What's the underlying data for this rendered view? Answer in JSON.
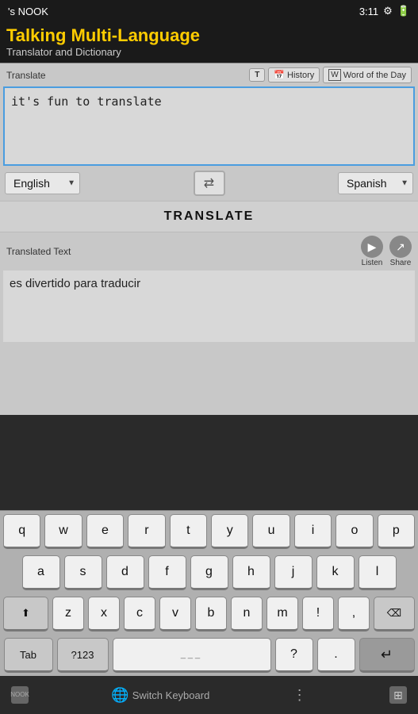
{
  "statusBar": {
    "appName": "'s NOOK",
    "time": "3:11",
    "icons": [
      "settings",
      "battery"
    ]
  },
  "header": {
    "title": "Talking Multi-Language",
    "subtitle": "Translator and Dictionary"
  },
  "toolbar": {
    "label": "Translate",
    "historyBtn": "History",
    "wordBtn": "Word of the Day"
  },
  "inputArea": {
    "text": "it's fun to translate"
  },
  "languages": {
    "source": "English",
    "target": "Spanish",
    "swapSymbol": "⇄"
  },
  "translateBtn": "TRANSLATE",
  "translatedSection": {
    "label": "Translated Text",
    "listenLabel": "Listen",
    "shareLabel": "Share",
    "outputText": "es divertido para traducir"
  },
  "keyboard": {
    "row1": [
      "q",
      "w",
      "e",
      "r",
      "t",
      "y",
      "u",
      "i",
      "o",
      "p"
    ],
    "row2": [
      "a",
      "s",
      "d",
      "f",
      "g",
      "h",
      "j",
      "k",
      "l"
    ],
    "row3": [
      "z",
      "x",
      "c",
      "v",
      "b",
      "n",
      "m",
      "!",
      ","
    ],
    "row4Special": [
      "Tab",
      "?123",
      "space",
      "?",
      "⏎"
    ],
    "shiftSymbol": "⬆",
    "backspaceSymbol": "⌫",
    "enterSymbol": "↵"
  },
  "systemBar": {
    "logoText": "NOOK",
    "switchKeyboard": "Switch Keyboard",
    "moreOptions": "⋮"
  }
}
